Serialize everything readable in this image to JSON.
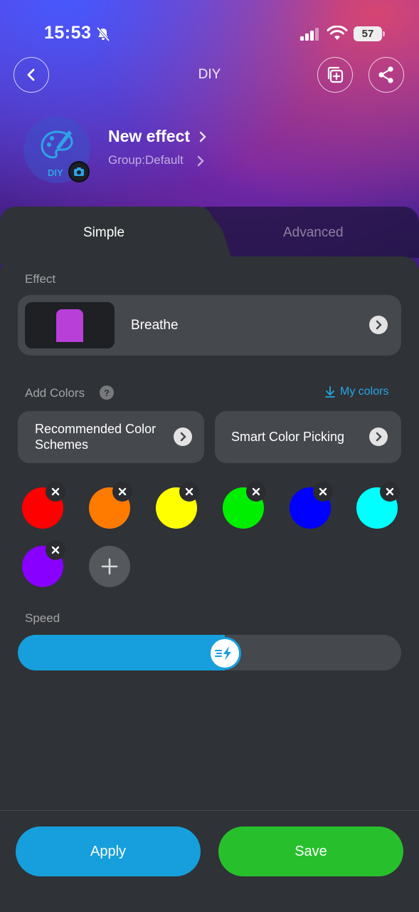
{
  "status_bar": {
    "time": "15:53",
    "battery": "57"
  },
  "header": {
    "title": "DIY"
  },
  "effect_info": {
    "name": "New effect",
    "group": "Group:Default",
    "avatar_label": "DIY"
  },
  "tabs": [
    {
      "label": "Simple",
      "active": true
    },
    {
      "label": "Advanced",
      "active": false
    }
  ],
  "effect_section": {
    "label": "Effect",
    "selected": "Breathe",
    "thumb_color": "#b83fd8"
  },
  "colors_section": {
    "label": "Add Colors",
    "help": "?",
    "my_colors": "My colors",
    "recommended": "Recommended Color Schemes",
    "smart": "Smart Color Picking",
    "swatches": [
      "#ff0000",
      "#ff7b00",
      "#ffff00",
      "#00ee00",
      "#0000ff",
      "#00ffff",
      "#8800ff"
    ]
  },
  "speed": {
    "label": "Speed",
    "level": 0.54
  },
  "actions": {
    "apply": "Apply",
    "save": "Save"
  }
}
